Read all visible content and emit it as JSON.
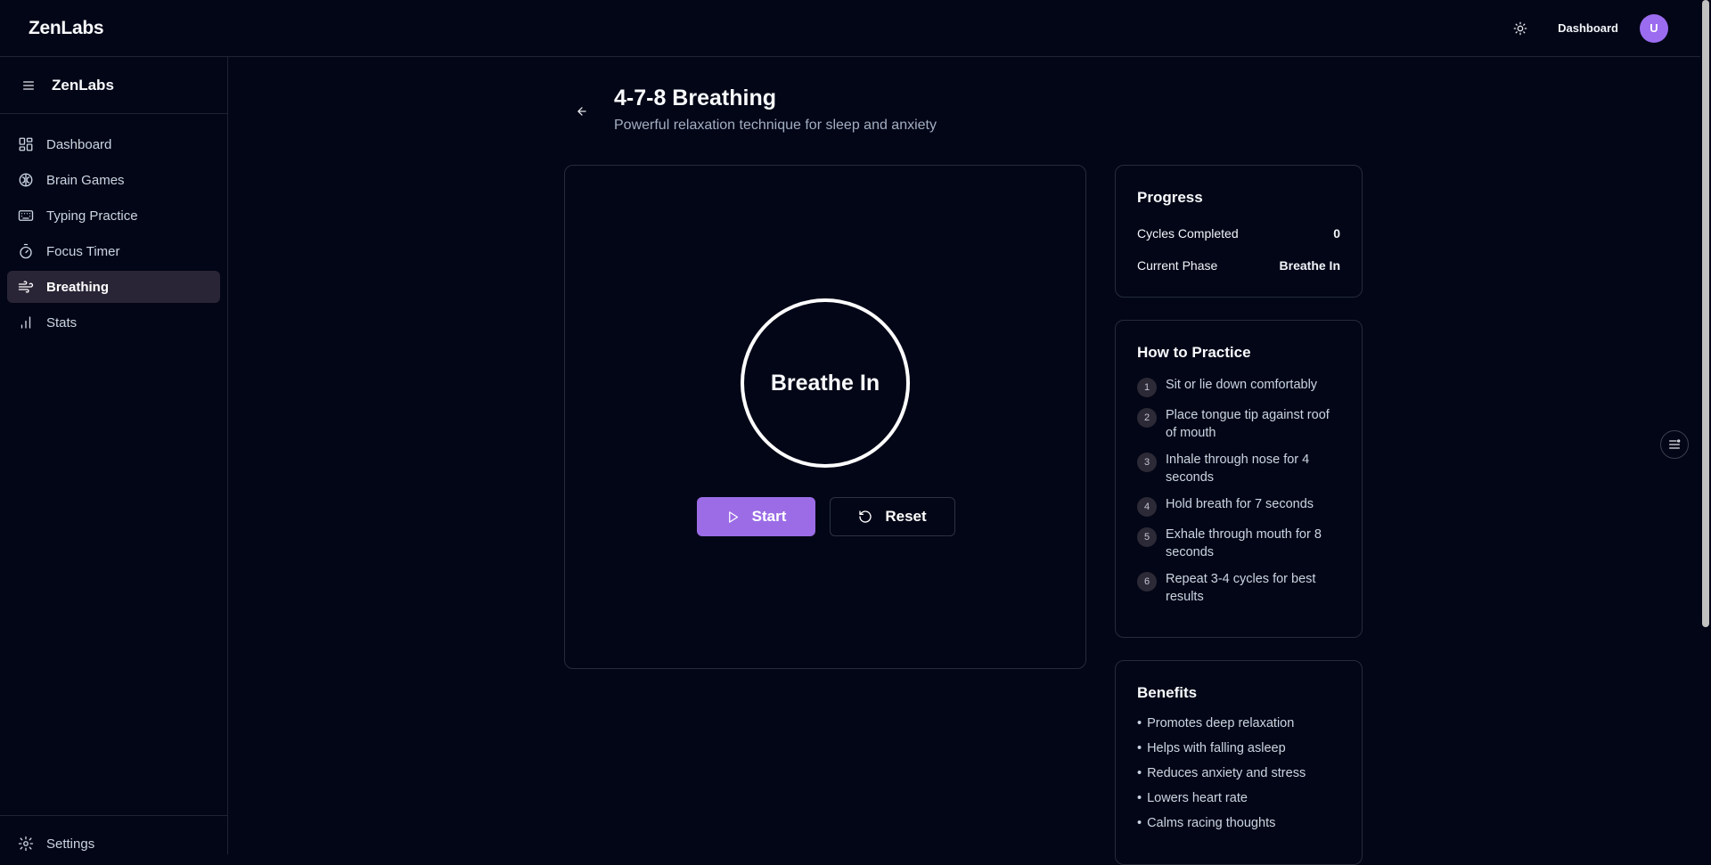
{
  "header": {
    "brand": "ZenLabs",
    "dashboard_link": "Dashboard",
    "avatar_initial": "U"
  },
  "sidebar": {
    "brand": "ZenLabs",
    "items": [
      {
        "label": "Dashboard",
        "icon": "grid-icon"
      },
      {
        "label": "Brain Games",
        "icon": "brain-icon"
      },
      {
        "label": "Typing Practice",
        "icon": "keyboard-icon"
      },
      {
        "label": "Focus Timer",
        "icon": "timer-icon"
      },
      {
        "label": "Breathing",
        "icon": "wind-icon",
        "active": true
      },
      {
        "label": "Stats",
        "icon": "bar-chart-icon"
      }
    ],
    "settings_label": "Settings"
  },
  "page": {
    "title": "4-7-8 Breathing",
    "subtitle": "Powerful relaxation technique for sleep and anxiety"
  },
  "exercise": {
    "phase_text": "Breathe In",
    "start_label": "Start",
    "reset_label": "Reset"
  },
  "progress": {
    "title": "Progress",
    "cycles_label": "Cycles Completed",
    "cycles_value": "0",
    "phase_label": "Current Phase",
    "phase_value": "Breathe In"
  },
  "practice": {
    "title": "How to Practice",
    "steps": [
      {
        "num": "1",
        "text": "Sit or lie down comfortably"
      },
      {
        "num": "2",
        "text": "Place tongue tip against roof of mouth"
      },
      {
        "num": "3",
        "text": "Inhale through nose for 4 seconds"
      },
      {
        "num": "4",
        "text": "Hold breath for 7 seconds"
      },
      {
        "num": "5",
        "text": "Exhale through mouth for 8 seconds"
      },
      {
        "num": "6",
        "text": "Repeat 3-4 cycles for best results"
      }
    ]
  },
  "benefits": {
    "title": "Benefits",
    "bullet": "•",
    "items": [
      "Promotes deep relaxation",
      "Helps with falling asleep",
      "Reduces anxiety and stress",
      "Lowers heart rate",
      "Calms racing thoughts"
    ]
  },
  "colors": {
    "background": "#030617",
    "accent": "#9b6ce6",
    "active_nav": "#2a2536"
  }
}
